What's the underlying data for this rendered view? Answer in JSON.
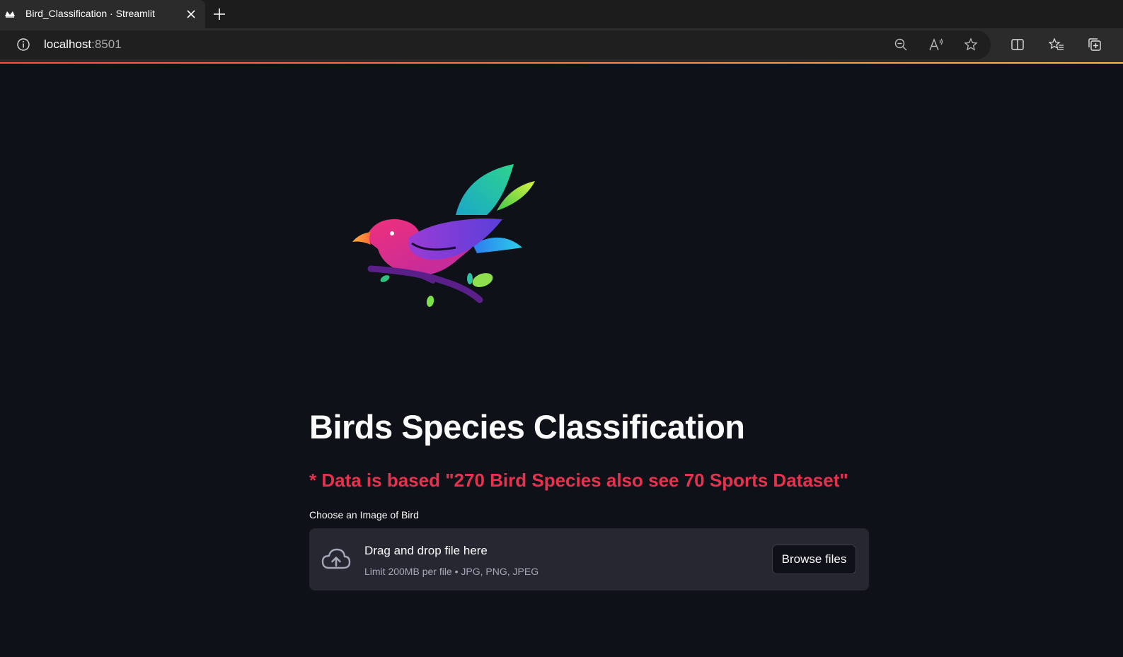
{
  "browser": {
    "tab_title": "Bird_Classification · Streamlit",
    "url_host": "localhost",
    "url_port": ":8501"
  },
  "app": {
    "title": "Birds Species Classification",
    "subtitle": "* Data is based \"270 Bird Species also see 70 Sports Dataset\"",
    "uploader": {
      "label": "Choose an Image of Bird",
      "drag_text": "Drag and drop file here",
      "limit_text": "Limit 200MB per file • JPG, PNG, JPEG",
      "browse_label": "Browse files"
    }
  },
  "colors": {
    "background": "#0e1117",
    "subtitle": "#e8314f",
    "dropzone": "#262730"
  },
  "icons": [
    "streamlit-favicon-icon",
    "close-icon",
    "plus-icon",
    "info-icon",
    "zoom-out-icon",
    "read-aloud-icon",
    "star-icon",
    "split-screen-icon",
    "favorites-icon",
    "collections-icon",
    "cloud-upload-icon"
  ]
}
